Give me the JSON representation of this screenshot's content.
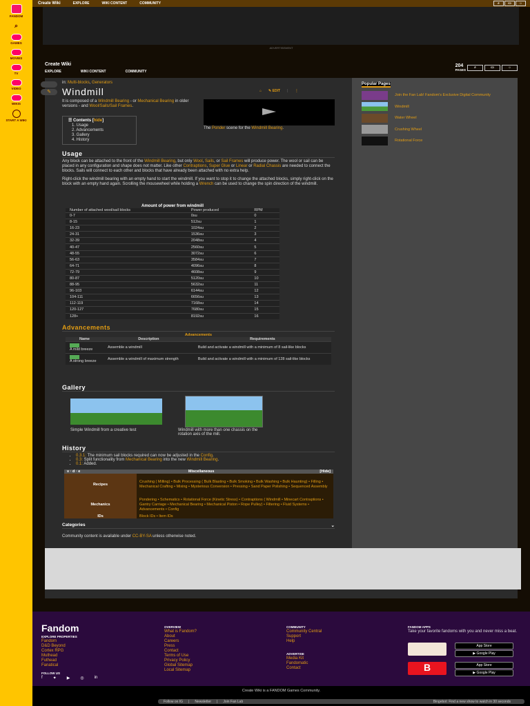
{
  "rail": [
    "FANDOM",
    "GAMES",
    "MOVIES",
    "TV",
    "VIDEO",
    "WIKIS",
    "START A WIKI"
  ],
  "top": {
    "title": "Create Wiki",
    "nav": [
      "EXPLORE",
      "WIKI CONTENT",
      "COMMUNITY"
    ]
  },
  "ad_label": "ADVERTISEMENT",
  "wiki": {
    "name": "Create Wiki",
    "nav": [
      "EXPLORE",
      "WIKI CONTENT",
      "COMMUNITY"
    ],
    "pages": "204",
    "pages_label": "PAGES"
  },
  "page": {
    "in": "in:",
    "cats": [
      "Multi-blocks",
      "Generators"
    ],
    "title": "Windmill",
    "edit": "EDIT",
    "intro": [
      "It is composed of a ",
      "Windmill Bearing",
      " - or ",
      "Mechanical Bearing",
      " in older versions - and ",
      "Wool/Sails/Sail Frames",
      "."
    ],
    "caption": [
      "The ",
      "Ponder",
      " scene for the ",
      "Windmill Bearing",
      "."
    ],
    "toc": {
      "title": "Contents",
      "hide": "hide",
      "items": [
        "1. Usage",
        "2. Advancements",
        "3. Gallery",
        "4. History"
      ]
    },
    "usage_h": "Usage",
    "usage_p1": [
      "Any block can be attached to the front of the ",
      "Windmill Bearing",
      ", but only ",
      "Wool",
      ", ",
      "Sails",
      ", or ",
      "Sail Frames",
      " will produce power. The wool or sail can be placed in any configuration and shape does not matter. Like other ",
      "Contraptions",
      ", ",
      "Super Glue",
      " or ",
      "Linear",
      " or ",
      "Radial Chassis",
      " are needed to connect the blocks. Sails will connect to each other and blocks that have already been attached with no extra help."
    ],
    "usage_p2": [
      "Right-click the windmill bearing with an empty hand to start the windmill. If you want to stop it to change the attached blocks, simply right-click on the block with an empty hand again. Scrolling the mousewheel while holding a ",
      "Wrench",
      " can be used to change the spin direction of the windmill."
    ],
    "power_table": {
      "caption": "Amount of power from windmill",
      "headers": [
        "Number of attached wool/sail blocks",
        "Power produced",
        "RPM"
      ],
      "rows": [
        [
          "0-7",
          "0su",
          "0"
        ],
        [
          "8-15",
          "512su",
          "1"
        ],
        [
          "16-23",
          "1024su",
          "2"
        ],
        [
          "24-31",
          "1536su",
          "3"
        ],
        [
          "32-39",
          "2048su",
          "4"
        ],
        [
          "40-47",
          "2560su",
          "5"
        ],
        [
          "48-55",
          "3072su",
          "6"
        ],
        [
          "56-63",
          "3584su",
          "7"
        ],
        [
          "64-71",
          "4096su",
          "8"
        ],
        [
          "72-79",
          "4608su",
          "9"
        ],
        [
          "80-87",
          "5120su",
          "10"
        ],
        [
          "88-95",
          "5632su",
          "11"
        ],
        [
          "96-103",
          "6144su",
          "12"
        ],
        [
          "104-111",
          "6656su",
          "13"
        ],
        [
          "112-119",
          "7168su",
          "14"
        ],
        [
          "120-127",
          "7680su",
          "15"
        ],
        [
          "128+",
          "8192su",
          "16"
        ]
      ]
    },
    "adv_h": "Advancements",
    "adv_table": {
      "caption": "Advancements",
      "headers": [
        "Name",
        "Description",
        "Requirements"
      ],
      "rows": [
        [
          "A mild breeze",
          "Assemble a windmill",
          "Build and activate a windmill with a minimum of 8 sail-like blocks"
        ],
        [
          "A strong breeze",
          "Assemble a windmill of maximum strength",
          "Build and activate a windmill with a minimum of 128 sail-like blocks"
        ]
      ]
    },
    "gallery_h": "Gallery",
    "gallery": [
      "Simple Windmill from a creative test",
      "Windmill with more than one chassis on the rotation axis of the mill."
    ],
    "history_h": "History",
    "history": [
      [
        "0.3.1:",
        " The minimum sail blocks required can now be adjusted in the ",
        "Config",
        "."
      ],
      [
        "0.3:",
        " Split functionality from ",
        "Mechanical Bearing",
        " into the new ",
        "Windmill Bearing",
        "."
      ],
      [
        "0.1:",
        " Added.",
        "",
        " "
      ]
    ],
    "navbox": {
      "vde": "v · d · e",
      "title": "Miscellaneous",
      "hide": "[Hide]",
      "recipes_label": "Recipes",
      "recipes": "Crushing ( Milling) • Bulk Processing ( Bulk Blasting • Bulk Smoking • Bulk Washing • Bulk Haunting) • Filling • Mechanical Crafting • Mixing • Mysterious Conversion • Pressing • Sand Paper Polishing • Sequenced Assembly",
      "mech_label": "Mechanics",
      "mech": "Pondering • Schematics • Rotational Force (Kinetic Stress) • Contraptions ( Windmill • Minecart Contraptions • Gantry Carriage • Mechanical Bearing • Mechanical Piston • Rope Pulley) • Filtering • Fluid Systems • Advancements • Config",
      "ids_label": "IDs",
      "ids": "Block IDs • Item IDs"
    },
    "categories": "Categories",
    "license": [
      "Community content is available under ",
      "CC-BY-SA",
      " unless otherwise noted."
    ]
  },
  "sidebar": {
    "title": "Popular Pages",
    "items": [
      "Join the Fan Lab! Fandom's Exclusive Digital Community",
      "Windmill",
      "Water Wheel",
      "Crushing Wheel",
      "Rotational Force"
    ]
  },
  "footer": {
    "logo": "Fandom",
    "explore_h": "EXPLORE PROPERTIES",
    "explore": [
      "Fandom",
      "D&D Beyond",
      "Cortex RPG",
      "Muthead",
      "Futhead",
      "Fanatical"
    ],
    "follow_h": "FOLLOW US",
    "overview_h": "OVERVIEW",
    "overview": [
      "What is Fandom?",
      "About",
      "Careers",
      "Press",
      "Contact",
      "Terms of Use",
      "Privacy Policy",
      "Global Sitemap",
      "Local Sitemap"
    ],
    "community_h": "COMMUNITY",
    "community": [
      "Community Central",
      "Support",
      "Help"
    ],
    "advertise_h": "ADVERTISE",
    "advertise": [
      "Media Kit",
      "Fandomatic",
      "Contact"
    ],
    "apps_h": "FANDOM APPS",
    "apps_text": "Take your favorite fandoms with you and never miss a beat.",
    "app_store": "App Store",
    "google_play": "Google Play"
  },
  "bottom": {
    "text": "Create Wiki is a FANDOM Games Community.",
    "bar": [
      "Follow on IG",
      "Newsletter",
      "Join Fan Lab"
    ],
    "promo": "Bingebot: Find a new show to watch in 30 seconds"
  },
  "colors": {
    "rail": "#ffc500",
    "link": "#e39d13",
    "footer": "#2b0a3d"
  }
}
